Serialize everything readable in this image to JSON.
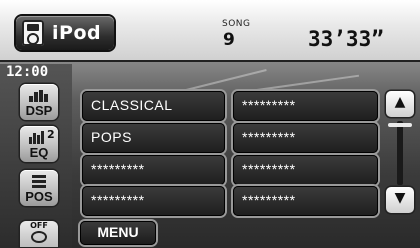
{
  "header": {
    "source_label": "iPod",
    "song_caption": "SONG",
    "song_number": "9",
    "elapsed_time": "33’33”"
  },
  "status": {
    "clock": "12:00"
  },
  "side_buttons": {
    "dsp_label": "DSP",
    "eq_label": "EQ",
    "eq_number": "2",
    "pos_label": "POS",
    "off_label": "OFF"
  },
  "list": {
    "left_column": [
      "CLASSICAL",
      "POPS",
      "*********",
      "*********"
    ],
    "right_column": [
      "*********",
      "*********",
      "*********",
      "*********"
    ]
  },
  "scroll": {
    "up_icon": "▲",
    "down_icon": "▼"
  },
  "footer": {
    "menu_label": "MENU"
  }
}
